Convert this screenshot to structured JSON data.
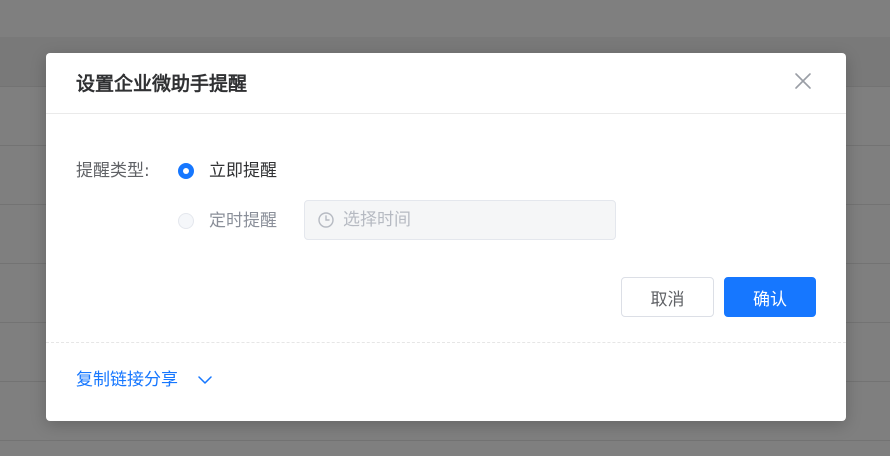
{
  "dialog": {
    "title": "设置企业微助手提醒",
    "field_label": "提醒类型:",
    "options": [
      {
        "label": "立即提醒",
        "checked": true,
        "disabled": false
      },
      {
        "label": "定时提醒",
        "checked": false,
        "disabled": true
      }
    ],
    "time_input": {
      "placeholder": "选择时间",
      "icon": "clock-icon"
    },
    "buttons": {
      "cancel": "取消",
      "confirm": "确认"
    },
    "share_link": {
      "label": "复制链接分享",
      "icon": "chevron-down-icon"
    },
    "close_icon": "close-icon"
  },
  "colors": {
    "primary": "#1677ff",
    "title": "#303133",
    "text": "#606266",
    "disabled_text": "#8a8f99",
    "overlay": "rgba(0,0,0,0.5)"
  }
}
